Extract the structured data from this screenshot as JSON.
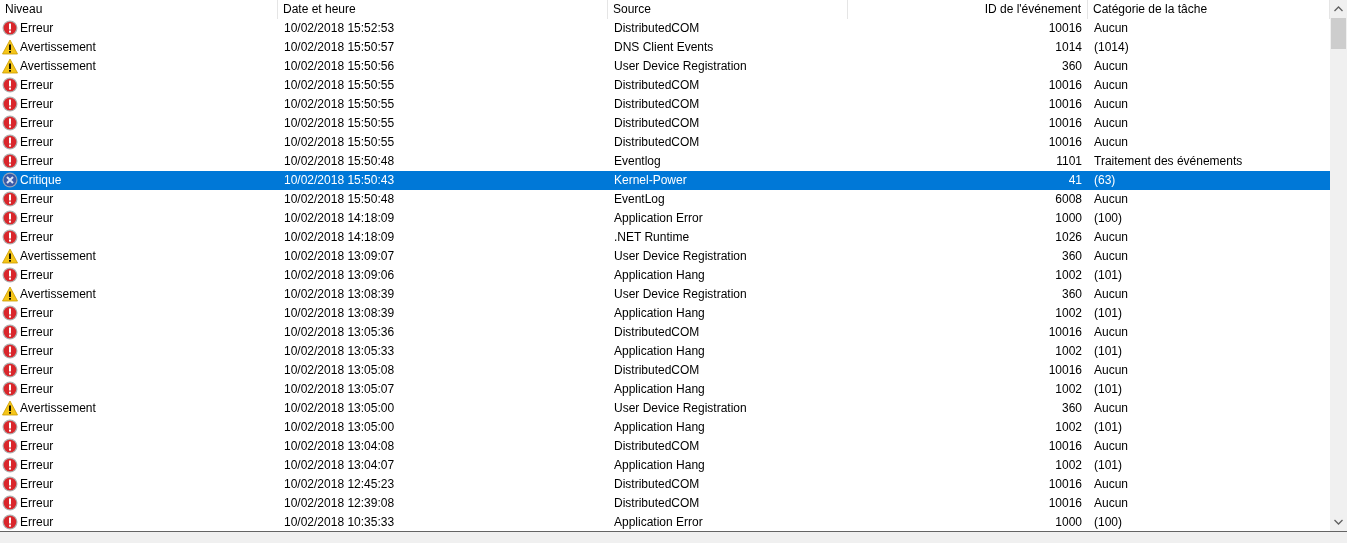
{
  "columns": [
    "Niveau",
    "Date et heure",
    "Source",
    "ID de l'événement",
    "Catégorie de la tâche"
  ],
  "rows": [
    {
      "kind": "error",
      "level": "Erreur",
      "date": "10/02/2018 15:52:53",
      "source": "DistributedCOM",
      "id": "10016",
      "category": "Aucun",
      "selected": false
    },
    {
      "kind": "warning",
      "level": "Avertissement",
      "date": "10/02/2018 15:50:57",
      "source": "DNS Client Events",
      "id": "1014",
      "category": "(1014)",
      "selected": false
    },
    {
      "kind": "warning",
      "level": "Avertissement",
      "date": "10/02/2018 15:50:56",
      "source": "User Device Registration",
      "id": "360",
      "category": "Aucun",
      "selected": false
    },
    {
      "kind": "error",
      "level": "Erreur",
      "date": "10/02/2018 15:50:55",
      "source": "DistributedCOM",
      "id": "10016",
      "category": "Aucun",
      "selected": false
    },
    {
      "kind": "error",
      "level": "Erreur",
      "date": "10/02/2018 15:50:55",
      "source": "DistributedCOM",
      "id": "10016",
      "category": "Aucun",
      "selected": false
    },
    {
      "kind": "error",
      "level": "Erreur",
      "date": "10/02/2018 15:50:55",
      "source": "DistributedCOM",
      "id": "10016",
      "category": "Aucun",
      "selected": false
    },
    {
      "kind": "error",
      "level": "Erreur",
      "date": "10/02/2018 15:50:55",
      "source": "DistributedCOM",
      "id": "10016",
      "category": "Aucun",
      "selected": false
    },
    {
      "kind": "error",
      "level": "Erreur",
      "date": "10/02/2018 15:50:48",
      "source": "Eventlog",
      "id": "1101",
      "category": "Traitement des événements",
      "selected": false
    },
    {
      "kind": "critical",
      "level": "Critique",
      "date": "10/02/2018 15:50:43",
      "source": "Kernel-Power",
      "id": "41",
      "category": "(63)",
      "selected": true
    },
    {
      "kind": "error",
      "level": "Erreur",
      "date": "10/02/2018 15:50:48",
      "source": "EventLog",
      "id": "6008",
      "category": "Aucun",
      "selected": false
    },
    {
      "kind": "error",
      "level": "Erreur",
      "date": "10/02/2018 14:18:09",
      "source": "Application Error",
      "id": "1000",
      "category": "(100)",
      "selected": false
    },
    {
      "kind": "error",
      "level": "Erreur",
      "date": "10/02/2018 14:18:09",
      "source": ".NET Runtime",
      "id": "1026",
      "category": "Aucun",
      "selected": false
    },
    {
      "kind": "warning",
      "level": "Avertissement",
      "date": "10/02/2018 13:09:07",
      "source": "User Device Registration",
      "id": "360",
      "category": "Aucun",
      "selected": false
    },
    {
      "kind": "error",
      "level": "Erreur",
      "date": "10/02/2018 13:09:06",
      "source": "Application Hang",
      "id": "1002",
      "category": "(101)",
      "selected": false
    },
    {
      "kind": "warning",
      "level": "Avertissement",
      "date": "10/02/2018 13:08:39",
      "source": "User Device Registration",
      "id": "360",
      "category": "Aucun",
      "selected": false
    },
    {
      "kind": "error",
      "level": "Erreur",
      "date": "10/02/2018 13:08:39",
      "source": "Application Hang",
      "id": "1002",
      "category": "(101)",
      "selected": false
    },
    {
      "kind": "error",
      "level": "Erreur",
      "date": "10/02/2018 13:05:36",
      "source": "DistributedCOM",
      "id": "10016",
      "category": "Aucun",
      "selected": false
    },
    {
      "kind": "error",
      "level": "Erreur",
      "date": "10/02/2018 13:05:33",
      "source": "Application Hang",
      "id": "1002",
      "category": "(101)",
      "selected": false
    },
    {
      "kind": "error",
      "level": "Erreur",
      "date": "10/02/2018 13:05:08",
      "source": "DistributedCOM",
      "id": "10016",
      "category": "Aucun",
      "selected": false
    },
    {
      "kind": "error",
      "level": "Erreur",
      "date": "10/02/2018 13:05:07",
      "source": "Application Hang",
      "id": "1002",
      "category": "(101)",
      "selected": false
    },
    {
      "kind": "warning",
      "level": "Avertissement",
      "date": "10/02/2018 13:05:00",
      "source": "User Device Registration",
      "id": "360",
      "category": "Aucun",
      "selected": false
    },
    {
      "kind": "error",
      "level": "Erreur",
      "date": "10/02/2018 13:05:00",
      "source": "Application Hang",
      "id": "1002",
      "category": "(101)",
      "selected": false
    },
    {
      "kind": "error",
      "level": "Erreur",
      "date": "10/02/2018 13:04:08",
      "source": "DistributedCOM",
      "id": "10016",
      "category": "Aucun",
      "selected": false
    },
    {
      "kind": "error",
      "level": "Erreur",
      "date": "10/02/2018 13:04:07",
      "source": "Application Hang",
      "id": "1002",
      "category": "(101)",
      "selected": false
    },
    {
      "kind": "error",
      "level": "Erreur",
      "date": "10/02/2018 12:45:23",
      "source": "DistributedCOM",
      "id": "10016",
      "category": "Aucun",
      "selected": false
    },
    {
      "kind": "error",
      "level": "Erreur",
      "date": "10/02/2018 12:39:08",
      "source": "DistributedCOM",
      "id": "10016",
      "category": "Aucun",
      "selected": false
    },
    {
      "kind": "error",
      "level": "Erreur",
      "date": "10/02/2018 10:35:33",
      "source": "Application Error",
      "id": "1000",
      "category": "(100)",
      "selected": false
    }
  ]
}
